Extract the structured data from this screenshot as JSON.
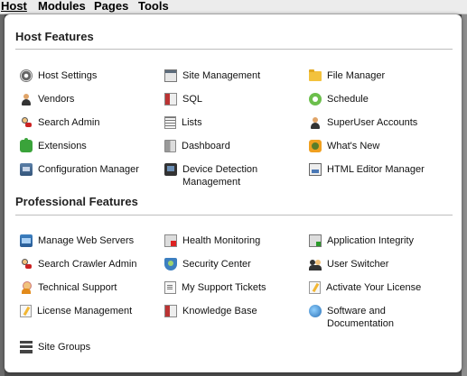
{
  "menubar": {
    "items": [
      "Host",
      "Modules",
      "Pages",
      "Tools"
    ]
  },
  "panel": {
    "sections": [
      {
        "title": "Host Features",
        "columns": [
          [
            {
              "label": "Host Settings",
              "icon": "gear-icon"
            },
            {
              "label": "Vendors",
              "icon": "person-icon"
            },
            {
              "label": "Search Admin",
              "icon": "search-admin-icon"
            },
            {
              "label": "Extensions",
              "icon": "puzzle-icon"
            },
            {
              "label": "Configuration Manager",
              "icon": "config-icon"
            }
          ],
          [
            {
              "label": "Site Management",
              "icon": "window-icon"
            },
            {
              "label": "SQL",
              "icon": "database-icon"
            },
            {
              "label": "Lists",
              "icon": "list-icon"
            },
            {
              "label": "Dashboard",
              "icon": "dashboard-icon"
            },
            {
              "label": "Device Detection Management",
              "icon": "device-icon"
            }
          ],
          [
            {
              "label": "File Manager",
              "icon": "folder-icon"
            },
            {
              "label": "Schedule",
              "icon": "schedule-icon"
            },
            {
              "label": "SuperUser Accounts",
              "icon": "person-icon"
            },
            {
              "label": "What's New",
              "icon": "star-icon"
            },
            {
              "label": "HTML Editor Manager",
              "icon": "html-icon"
            }
          ]
        ]
      },
      {
        "title": "Professional Features",
        "columns": [
          [
            {
              "label": "Manage Web Servers",
              "icon": "servers-icon"
            },
            {
              "label": "Search Crawler Admin",
              "icon": "search-admin-icon"
            },
            {
              "label": "Technical Support",
              "icon": "support-icon"
            },
            {
              "label": "License Management",
              "icon": "pencil-icon"
            },
            {
              "label": "Site Groups",
              "icon": "site-groups-icon"
            }
          ],
          [
            {
              "label": "Health Monitoring",
              "icon": "health-icon"
            },
            {
              "label": "Security Center",
              "icon": "shield-icon"
            },
            {
              "label": "My Support Tickets",
              "icon": "ticket-icon"
            },
            {
              "label": "Knowledge Base",
              "icon": "database-icon"
            }
          ],
          [
            {
              "label": "Application Integrity",
              "icon": "integrity-icon"
            },
            {
              "label": "User Switcher",
              "icon": "switcher-icon"
            },
            {
              "label": "Activate Your License",
              "icon": "pencil-icon"
            },
            {
              "label": "Software and Documentation",
              "icon": "globe-icon"
            }
          ]
        ]
      }
    ]
  }
}
